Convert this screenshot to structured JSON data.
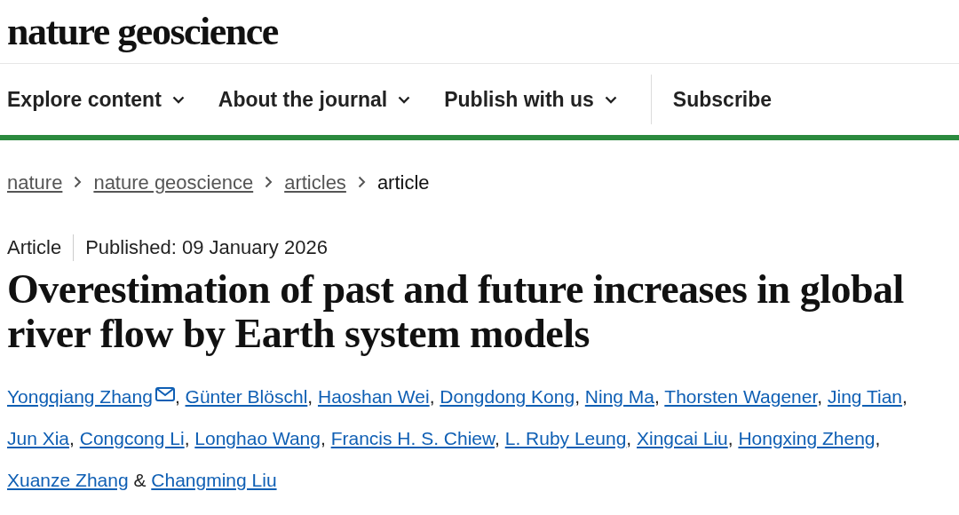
{
  "logo": "nature geoscience",
  "nav": [
    {
      "label": "Explore content",
      "dropdown": true
    },
    {
      "label": "About the journal",
      "dropdown": true
    },
    {
      "label": "Publish with us",
      "dropdown": true
    },
    {
      "label": "Subscribe",
      "dropdown": false
    }
  ],
  "breadcrumbs": [
    {
      "label": "nature",
      "link": true
    },
    {
      "label": "nature geoscience",
      "link": true
    },
    {
      "label": "articles",
      "link": true
    },
    {
      "label": "article",
      "link": false
    }
  ],
  "article_type": "Article",
  "published": "Published: 09 January 2026",
  "title": "Overestimation of past and future increases in global river flow by Earth system models",
  "authors": [
    {
      "name": "Yongqiang Zhang",
      "email": true,
      "separator": ","
    },
    {
      "name": "Günter Blöschl",
      "email": false,
      "separator": ","
    },
    {
      "name": "Haoshan Wei",
      "email": false,
      "separator": ","
    },
    {
      "name": "Dongdong Kong",
      "email": false,
      "separator": ","
    },
    {
      "name": "Ning Ma",
      "email": false,
      "separator": ","
    },
    {
      "name": "Thorsten Wagener",
      "email": false,
      "separator": ","
    },
    {
      "name": "Jing Tian",
      "email": false,
      "separator": ","
    },
    {
      "name": "Jun Xia",
      "email": false,
      "separator": ","
    },
    {
      "name": "Congcong Li",
      "email": false,
      "separator": ","
    },
    {
      "name": "Longhao Wang",
      "email": false,
      "separator": ","
    },
    {
      "name": "Francis H. S. Chiew",
      "email": false,
      "separator": ","
    },
    {
      "name": "L. Ruby Leung",
      "email": false,
      "separator": ","
    },
    {
      "name": "Xingcai Liu",
      "email": false,
      "separator": ","
    },
    {
      "name": "Hongxing Zheng",
      "email": false,
      "separator": ","
    },
    {
      "name": "Xuanze Zhang",
      "email": false,
      "separator": " &"
    },
    {
      "name": "Changming Liu",
      "email": false
    }
  ]
}
